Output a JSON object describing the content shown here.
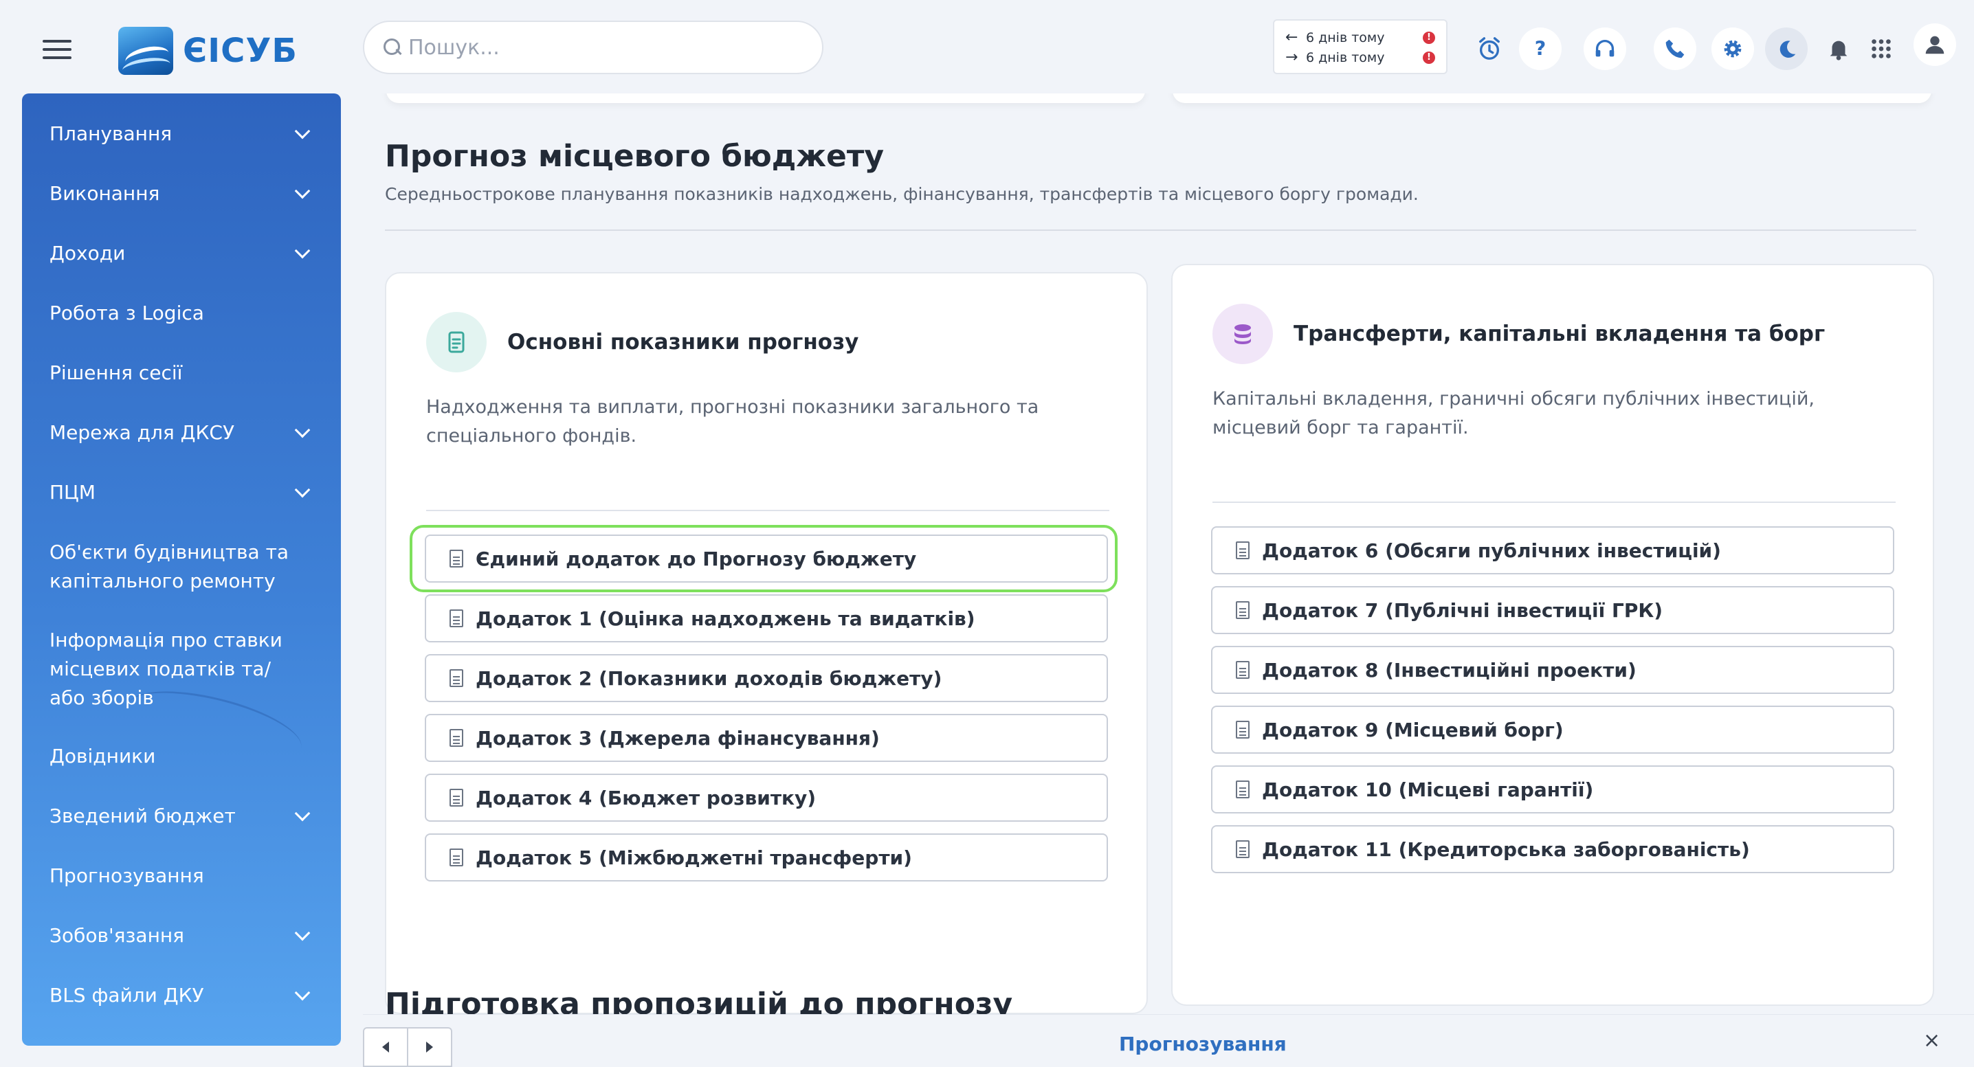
{
  "app": {
    "logo_text": "ЄІСУБ"
  },
  "search": {
    "placeholder": "Пошук..."
  },
  "history": [
    {
      "label": "6 днів тому",
      "arrow": "←"
    },
    {
      "label": "6 днів тому",
      "arrow": "→"
    }
  ],
  "toolbar_icons": [
    "alarm-clock-icon",
    "help-icon",
    "headset-icon",
    "phone-icon",
    "gear-icon",
    "moon-icon",
    "bell-icon",
    "apps-grid-icon",
    "user-icon"
  ],
  "sidebar": {
    "items": [
      {
        "label": "Планування",
        "expandable": true
      },
      {
        "label": "Виконання",
        "expandable": true
      },
      {
        "label": "Доходи",
        "expandable": true
      },
      {
        "label": "Робота з Logica",
        "expandable": false
      },
      {
        "label": "Рішення сесії",
        "expandable": false
      },
      {
        "label": "Мережа для ДКСУ",
        "expandable": true
      },
      {
        "label": "ПЦМ",
        "expandable": true
      },
      {
        "label": "Об'єкти будівництва та капітального ремонту",
        "expandable": false
      },
      {
        "label": "Інформація про ставки місцевих податків та/або зборів",
        "expandable": false
      },
      {
        "label": "Довідники",
        "expandable": false
      },
      {
        "label": "Зведений бюджет",
        "expandable": true
      },
      {
        "label": "Прогнозування",
        "expandable": false
      },
      {
        "label": "Зобов'язання",
        "expandable": true
      },
      {
        "label": "BLS файли ДКУ",
        "expandable": true
      }
    ]
  },
  "page": {
    "title": "Прогноз місцевого бюджету",
    "subtitle": "Середньострокове планування показників надходжень, фінансування, трансфертів та місцевого боргу громади.",
    "section2_title": "Підготовка пропозицій до прогнозу"
  },
  "cards": {
    "left": {
      "title": "Основні показники прогнозу",
      "description": "Надходження та виплати, прогнозні показники загального та спеціального фондів.",
      "links": [
        "Єдиний додаток до Прогнозу бюджету",
        "Додаток 1 (Оцінка надходжень та видатків)",
        "Додаток 2 (Показники доходів бюджету)",
        "Додаток 3 (Джерела фінансування)",
        "Додаток 4 (Бюджет розвитку)",
        "Додаток 5 (Міжбюджетні трансферти)"
      ],
      "icon_color": "#3ba99c"
    },
    "right": {
      "title": "Трансферти, капітальні вкладення та борг",
      "description": "Капітальні вкладення, граничні обсяги публічних інвестицій, місцевий борг та гарантії.",
      "links": [
        "Додаток 6 (Обсяги публічних інвестицій)",
        "Додаток 7 (Публічні інвестиції ГРК)",
        "Додаток 8 (Інвестиційні проекти)",
        "Додаток 9 (Місцевий борг)",
        "Додаток 10 (Місцеві гарантії)",
        "Додаток 11 (Кредиторська заборгованість)"
      ],
      "icon_color": "#9b59c9"
    }
  },
  "bottom_bar": {
    "title": "Прогнозування",
    "close": "×"
  },
  "colors": {
    "accent": "#2f6fc0",
    "highlight": "#7ee05c",
    "alert": "#d9343f"
  }
}
